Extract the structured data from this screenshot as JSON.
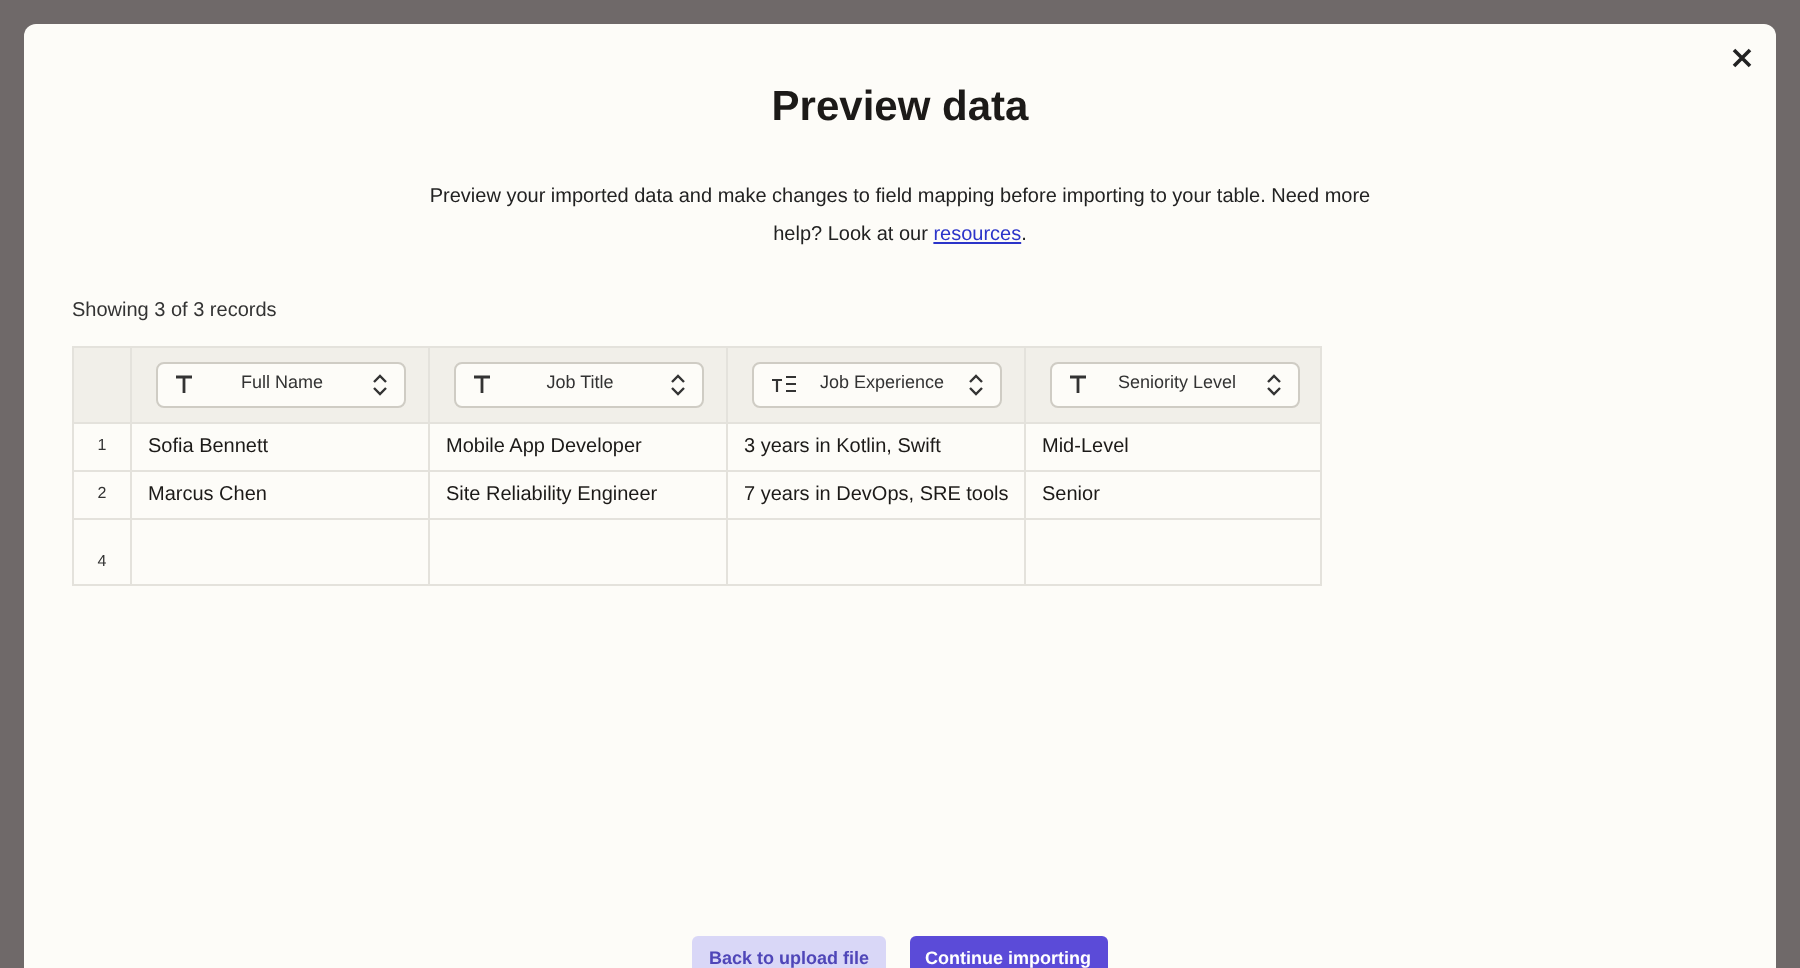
{
  "dialog": {
    "title": "Preview data",
    "description": "Preview your imported data and make changes to field mapping before importing to your table. Need more help? Look at our ",
    "link": "resources",
    "after_link": "."
  },
  "table": {
    "record_count": "Showing 3 of 3 records",
    "columns": [
      {
        "label": "Full Name",
        "kind": "text"
      },
      {
        "label": "Job Title",
        "kind": "text"
      },
      {
        "label": "Job Experience",
        "kind": "long_text"
      },
      {
        "label": "Seniority Level",
        "kind": "text"
      }
    ],
    "rows": [
      {
        "number": "1",
        "cells": [
          "Sofia Bennett",
          "Mobile App Developer",
          "3 years in Kotlin, Swift",
          "Mid-Level"
        ]
      },
      {
        "number": "2",
        "cells": [
          "Marcus Chen",
          "Site Reliability Engineer",
          "7 years in DevOps, SRE tools",
          "Senior"
        ]
      },
      {
        "number": "4"
      }
    ]
  },
  "buttons": [
    {
      "label": "Back to upload file",
      "kind": "secondary"
    },
    {
      "label": "Continue importing",
      "kind": "primary"
    }
  ]
}
